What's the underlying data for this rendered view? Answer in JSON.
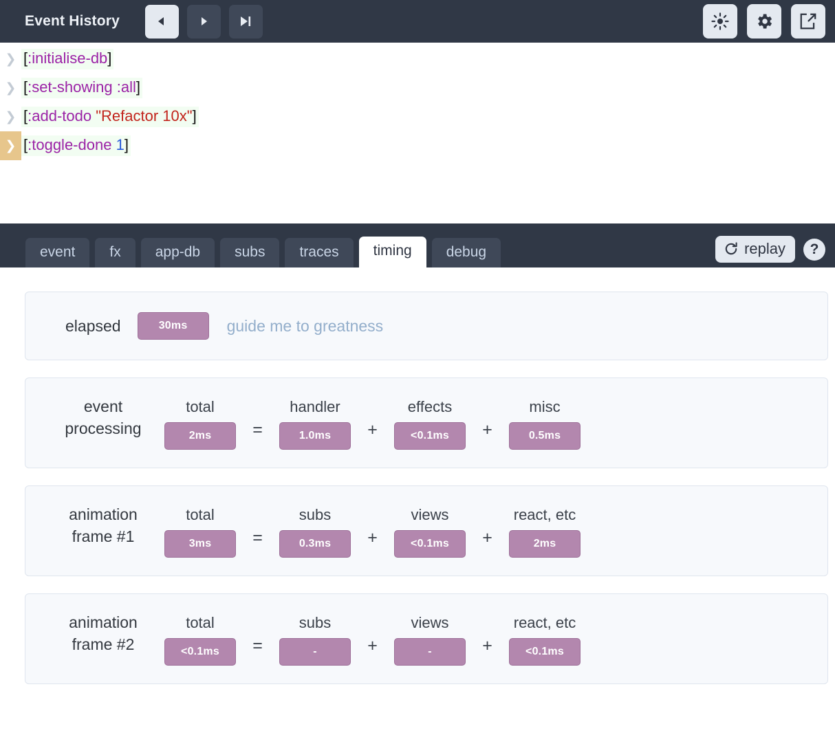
{
  "header": {
    "title": "Event History",
    "nav": [
      {
        "name": "step-back",
        "icon": "triangle-left-icon",
        "active": true
      },
      {
        "name": "step-forward",
        "icon": "triangle-right-icon",
        "active": false
      },
      {
        "name": "skip-to-end",
        "icon": "skip-end-icon",
        "active": false
      }
    ],
    "icons": [
      {
        "name": "brightness-icon",
        "label": "sun-icon"
      },
      {
        "name": "settings-icon",
        "label": "gear-icon"
      },
      {
        "name": "popout-icon",
        "label": "external-link-icon"
      }
    ]
  },
  "events": [
    {
      "selected": false,
      "parts": [
        {
          "text": "[",
          "kind": "brk"
        },
        {
          "text": ":initialise-db",
          "kind": "kw"
        },
        {
          "text": "]",
          "kind": "brk"
        }
      ]
    },
    {
      "selected": false,
      "parts": [
        {
          "text": "[",
          "kind": "brk"
        },
        {
          "text": ":set-showing",
          "kind": "kw"
        },
        {
          "text": " ",
          "kind": "brk"
        },
        {
          "text": ":all",
          "kind": "kw"
        },
        {
          "text": "]",
          "kind": "brk"
        }
      ]
    },
    {
      "selected": false,
      "parts": [
        {
          "text": "[",
          "kind": "brk"
        },
        {
          "text": ":add-todo",
          "kind": "kw"
        },
        {
          "text": " ",
          "kind": "brk"
        },
        {
          "text": "\"Refactor 10x\"",
          "kind": "str"
        },
        {
          "text": "]",
          "kind": "brk"
        }
      ]
    },
    {
      "selected": true,
      "parts": [
        {
          "text": "[",
          "kind": "brk"
        },
        {
          "text": ":toggle-done",
          "kind": "kw"
        },
        {
          "text": " ",
          "kind": "brk"
        },
        {
          "text": "1",
          "kind": "num"
        },
        {
          "text": "]",
          "kind": "brk"
        }
      ]
    }
  ],
  "tabs": [
    {
      "label": "event",
      "active": false
    },
    {
      "label": "fx",
      "active": false
    },
    {
      "label": "app-db",
      "active": false
    },
    {
      "label": "subs",
      "active": false
    },
    {
      "label": "traces",
      "active": false
    },
    {
      "label": "timing",
      "active": true
    },
    {
      "label": "debug",
      "active": false
    }
  ],
  "tabbar_actions": {
    "replay_label": "replay",
    "help_label": "?"
  },
  "timing": {
    "elapsed": {
      "label": "elapsed",
      "value": "30ms",
      "hint": "guide me to greatness"
    },
    "rows": [
      {
        "label_line1": "event",
        "label_line2": "processing",
        "total_label": "total",
        "total_value": "2ms",
        "eq": "=",
        "parts": [
          {
            "label": "handler",
            "value": "1.0ms",
            "op": "+"
          },
          {
            "label": "effects",
            "value": "<0.1ms",
            "op": "+"
          },
          {
            "label": "misc",
            "value": "0.5ms",
            "op": ""
          }
        ]
      },
      {
        "label_line1": "animation",
        "label_line2": "frame #1",
        "total_label": "total",
        "total_value": "3ms",
        "eq": "=",
        "parts": [
          {
            "label": "subs",
            "value": "0.3ms",
            "op": "+"
          },
          {
            "label": "views",
            "value": "<0.1ms",
            "op": "+"
          },
          {
            "label": "react, etc",
            "value": "2ms",
            "op": ""
          }
        ]
      },
      {
        "label_line1": "animation",
        "label_line2": "frame #2",
        "total_label": "total",
        "total_value": "<0.1ms",
        "eq": "=",
        "parts": [
          {
            "label": "subs",
            "value": "-",
            "op": "+"
          },
          {
            "label": "views",
            "value": "-",
            "op": "+"
          },
          {
            "label": "react, etc",
            "value": "<0.1ms",
            "op": ""
          }
        ]
      }
    ]
  },
  "colors": {
    "header_bg": "#303846",
    "pill": "#b387ae",
    "selected_gutter": "#e7c68c",
    "code_bg": "#f2fdf2",
    "keyword": "#9b23a6",
    "string": "#c2241c",
    "number": "#2558d8",
    "hint": "#93aecb"
  }
}
